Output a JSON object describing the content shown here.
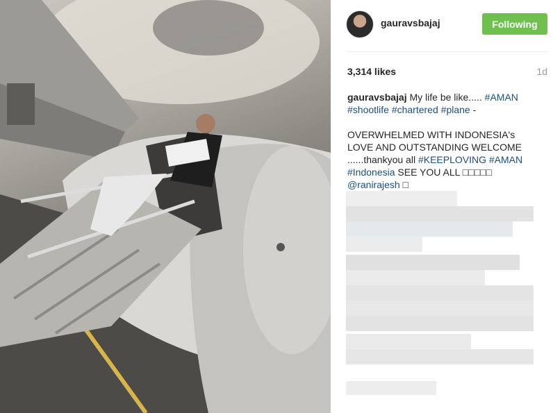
{
  "post": {
    "username": "gauravsbajaj",
    "follow_label": "Following",
    "likes": "3,314 likes",
    "age": "1d"
  },
  "caption": {
    "username": "gauravsbajaj",
    "line1_text": " My life be like..... ",
    "tag_aman1": "#AMAN",
    "tag_shootlife": "#shootlife",
    "tag_chartered": "#chartered",
    "tag_plane": "#plane",
    "dash": " -",
    "para2_line1": "OVERWHELMED WITH INDONESIA's",
    "para2_line2": "LOVE AND OUTSTANDING WELCOME",
    "para2_line3": "......thankyou all ",
    "tag_keeploving": "#KEEPLOVING",
    "tag_aman2": "#AMAN",
    "tag_indonesia": "#Indonesia",
    "see_you": " SEE YOU ALL □□□□□",
    "mention": "@ranirajesh",
    "trail": " □"
  },
  "colors": {
    "follow_green": "#70c050",
    "hashtag_blue": "#1a4f7a",
    "muted": "#999999"
  },
  "icons": {
    "avatar": "profile-photo"
  }
}
